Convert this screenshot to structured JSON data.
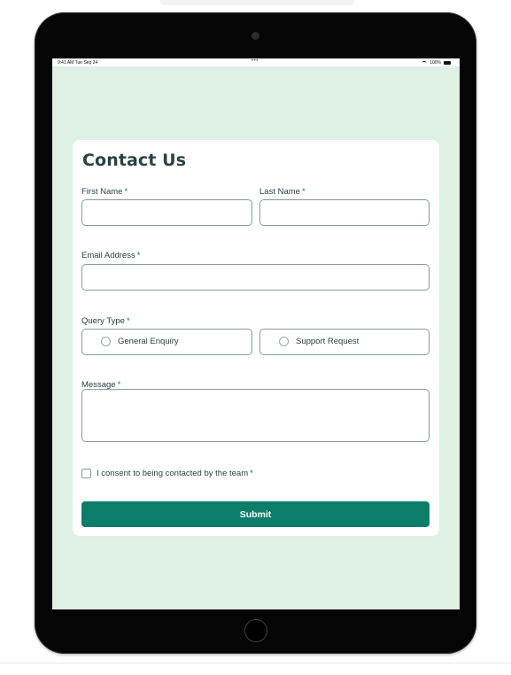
{
  "status_bar": {
    "time": "9:41 AM  Tue Sep 24",
    "dots": "•••",
    "battery": "100%"
  },
  "form": {
    "title": "Contact Us",
    "required_marker": "*",
    "first_name": {
      "label": "First Name",
      "value": "",
      "placeholder": ""
    },
    "last_name": {
      "label": "Last Name",
      "value": "",
      "placeholder": ""
    },
    "email": {
      "label": "Email Address",
      "value": "",
      "placeholder": ""
    },
    "query_type": {
      "label": "Query Type",
      "options": [
        "General Enquiry",
        "Support Request"
      ],
      "selected": ""
    },
    "message": {
      "label": "Message",
      "value": "",
      "placeholder": ""
    },
    "consent": {
      "label": "I consent to being contacted by the team",
      "checked": false
    },
    "submit_label": "Submit"
  },
  "colors": {
    "accent": "#0c7d68",
    "background": "#dff0e5",
    "text": "#2a4244",
    "card": "#ffffff"
  },
  "icons": {
    "device_camera": "camera-icon",
    "home_button": "home-button-icon",
    "wifi": "wifi-icon",
    "battery": "battery-icon"
  }
}
